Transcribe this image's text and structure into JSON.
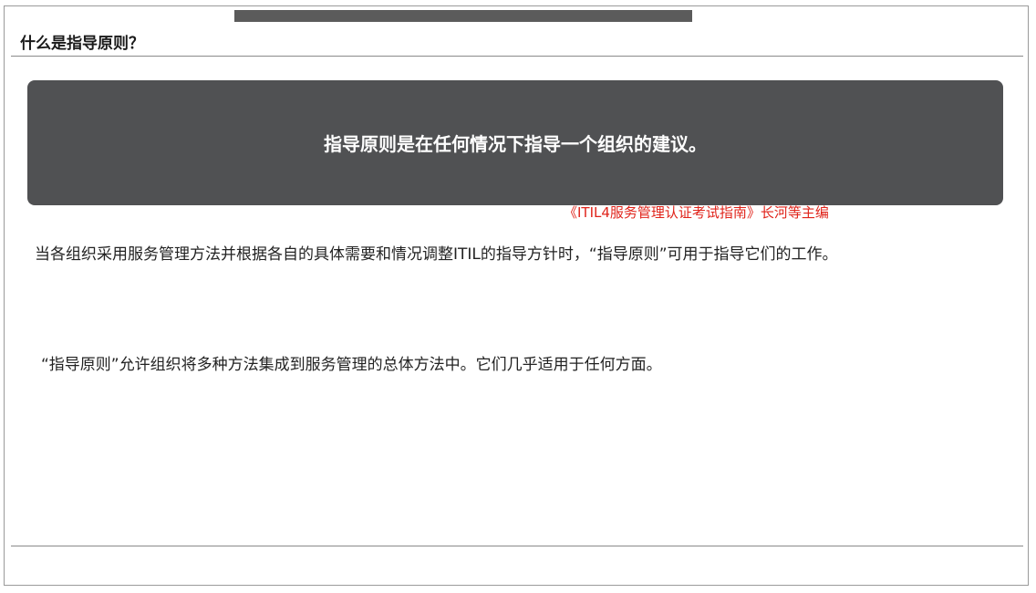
{
  "header": {
    "title": "什么是指导原则？"
  },
  "definition": {
    "text": "指导原则是在任何情况下指导一个组织的建议。",
    "source": "《ITIL4服务管理认证考试指南》长河等主编"
  },
  "body": {
    "paragraphs": [
      "当各组织采用服务管理方法并根据各自的具体需要和情况调整ITIL的指导方针时，“指导原则”可用于指导它们的工作。",
      "“指导原则”允许组织将多种方法集成到服务管理的总体方法中。它们几乎适用于任何方面。"
    ]
  },
  "colors": {
    "definition_bg": "#505153",
    "citation": "#e0241b"
  }
}
